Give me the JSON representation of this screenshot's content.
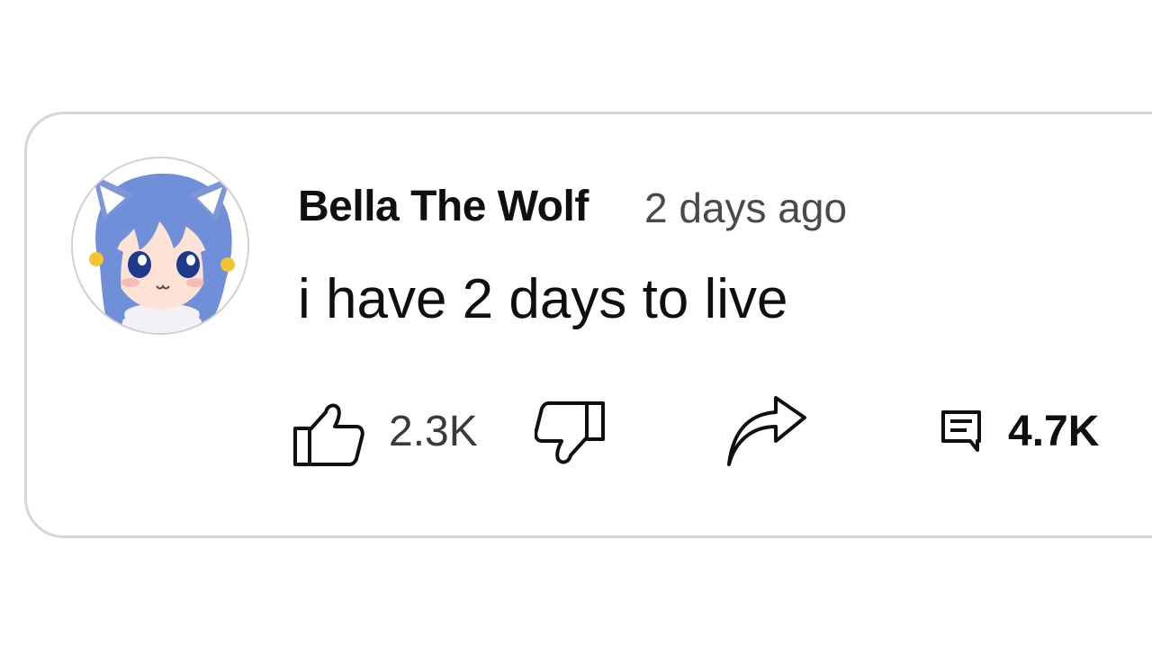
{
  "comment": {
    "author": "Bella The Wolf",
    "timestamp": "2 days ago",
    "text": "i have 2 days to live",
    "likes": "2.3K",
    "replies": "4.7K"
  },
  "icons": {
    "like": "thumbs-up-icon",
    "dislike": "thumbs-down-icon",
    "share": "share-arrow-icon",
    "reply": "comment-bubble-icon"
  },
  "colors": {
    "text_primary": "#0f0f0f",
    "text_secondary": "#4a4a4a",
    "card_border": "#d6d6d6",
    "avatar_hair": "#6f8fd8"
  }
}
